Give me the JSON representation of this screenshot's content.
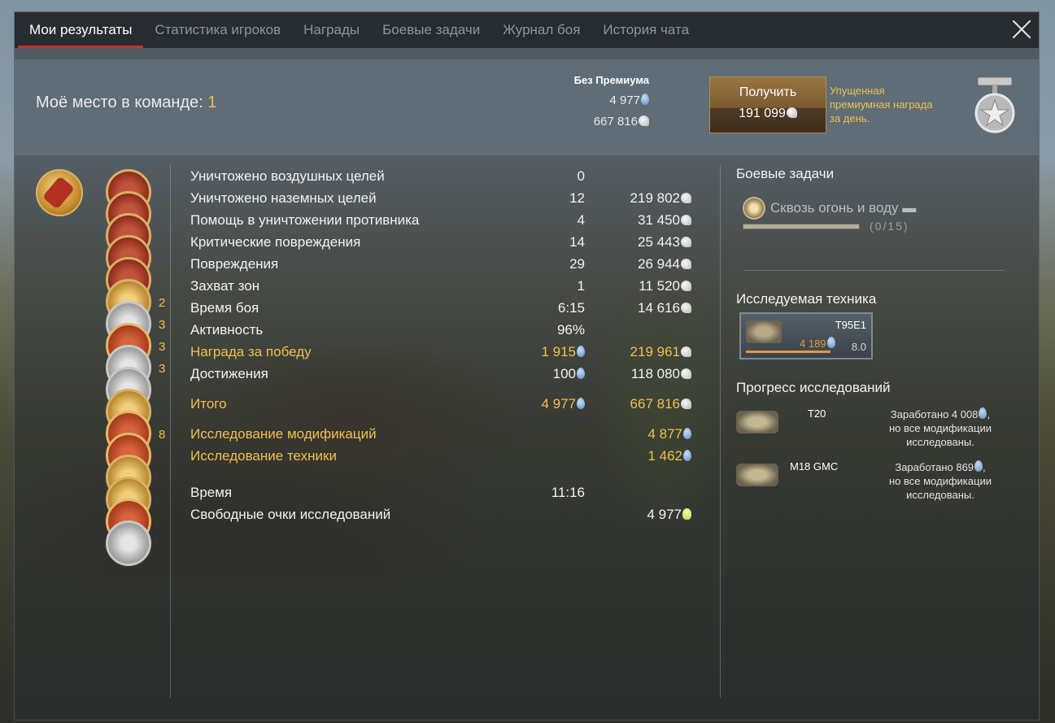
{
  "tabs": [
    {
      "label": "Мои результаты",
      "active": true
    },
    {
      "label": "Статистика игроков"
    },
    {
      "label": "Награды"
    },
    {
      "label": "Боевые задачи"
    },
    {
      "label": "Журнал боя"
    },
    {
      "label": "История чата"
    }
  ],
  "header": {
    "team_place_label": "Моё место в команде:",
    "team_place_value": "1",
    "premium_header": "Без Премиума",
    "premium_rp": "4 977",
    "premium_sl": "667 816",
    "get_button_label": "Получить",
    "get_button_value": "191 099",
    "missed_reward_text": "Упущенная премиумная награда за день."
  },
  "stats": [
    {
      "label": "Уничтожено воздушных целей",
      "v1": "0",
      "v2": ""
    },
    {
      "label": "Уничтожено наземных целей",
      "v1": "12",
      "v2": "219 802"
    },
    {
      "label": "Помощь в уничтожении противника",
      "v1": "4",
      "v2": "31 450"
    },
    {
      "label": "Критические повреждения",
      "v1": "14",
      "v2": "25 443"
    },
    {
      "label": "Повреждения",
      "v1": "29",
      "v2": "26 944"
    },
    {
      "label": "Захват зон",
      "v1": "1",
      "v2": "11 520"
    },
    {
      "label": "Время боя",
      "v1": "6:15",
      "v2": "14 616"
    },
    {
      "label": "Активность",
      "v1": "96%",
      "v2": ""
    },
    {
      "label": "Награда за победу",
      "v1": "1 915",
      "v2": "219 961"
    },
    {
      "label": "Достижения",
      "v1": "100",
      "v2": "118 080"
    }
  ],
  "total": {
    "label": "Итого",
    "rp": "4 977",
    "sl": "667 816"
  },
  "research": [
    {
      "label": "Исследование модификаций",
      "value": "4 877"
    },
    {
      "label": "Исследование техники",
      "value": "1 462"
    }
  ],
  "time": {
    "label": "Время",
    "value": "11:16"
  },
  "free_rp": {
    "label": "Свободные очки исследований",
    "value": "4 977"
  },
  "achievement_counts": [
    "2",
    "3",
    "3",
    "3",
    "8"
  ],
  "right": {
    "tasks_title": "Боевые задачи",
    "task_name": "Сквозь огонь и воду",
    "task_count": "(0/15)",
    "researched_title": "Исследуемая техника",
    "vehicle": {
      "name": "T95E1",
      "rp": "4 189",
      "br": "8.0"
    },
    "progress_title": "Прогресс исследований",
    "progress": [
      {
        "name": "T20",
        "note_a": "Заработано 4 008",
        "note_b": "но все модификации исследованы."
      },
      {
        "name": "M18 GMC",
        "note_a": "Заработано 869",
        "note_b": "но все модификации исследованы."
      }
    ]
  },
  "colors": {
    "accent": "#c1322b",
    "gold": "#f0c04e",
    "rp_blue": "#5b8fc9",
    "orange": "#e39a3c"
  },
  "icons": [
    "close-icon",
    "silver-lions-icon",
    "research-points-icon",
    "free-research-points-icon",
    "medal-icon",
    "tank-icon"
  ]
}
